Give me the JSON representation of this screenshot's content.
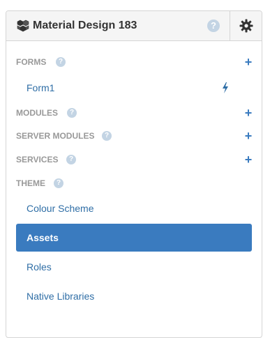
{
  "header": {
    "title": "Material Design 183",
    "app_icon": "cubes-icon",
    "help_icon": "question-circle-icon",
    "help_glyph": "?",
    "settings_icon": "gear-icon"
  },
  "sections": {
    "forms": {
      "label": "FORMS",
      "help_glyph": "?",
      "add_glyph": "+"
    },
    "modules": {
      "label": "MODULES",
      "help_glyph": "?",
      "add_glyph": "+"
    },
    "server_modules": {
      "label": "SERVER MODULES",
      "help_glyph": "?",
      "add_glyph": "+"
    },
    "services": {
      "label": "SERVICES",
      "help_glyph": "?",
      "add_glyph": "+"
    },
    "theme": {
      "label": "THEME",
      "help_glyph": "?"
    }
  },
  "forms_items": [
    {
      "label": "Form1",
      "icon": "lightning-bolt-icon"
    }
  ],
  "theme_items": [
    {
      "label": "Colour Scheme",
      "active": false
    },
    {
      "label": "Assets",
      "active": true
    },
    {
      "label": "Roles",
      "active": false
    },
    {
      "label": "Native Libraries",
      "active": false
    }
  ],
  "colors": {
    "accent": "#3a7bbf",
    "section_label": "#999999",
    "link": "#2f6ea6",
    "help_icon": "#c3d4e4"
  }
}
